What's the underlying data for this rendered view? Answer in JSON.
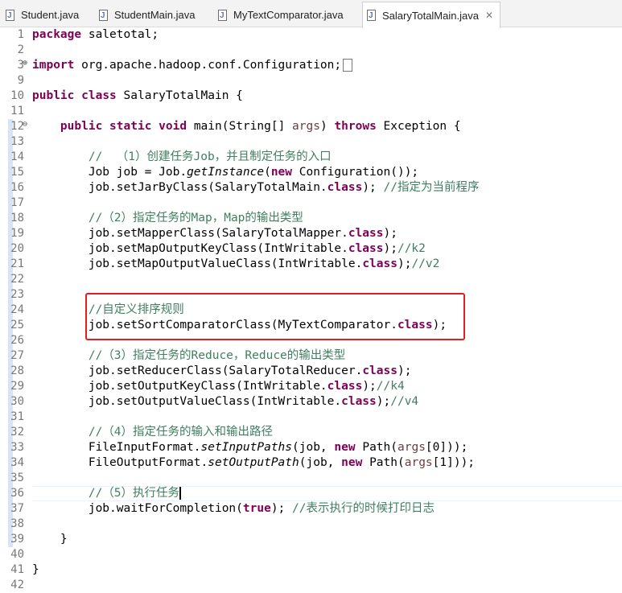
{
  "tabs": [
    {
      "label": "Student.java",
      "active": false
    },
    {
      "label": "StudentMain.java",
      "active": false
    },
    {
      "label": "MyTextComparator.java",
      "active": false
    },
    {
      "label": "SalaryTotalMain.java",
      "active": true
    }
  ],
  "tab_close_glyph": "✕",
  "code_lines": [
    {
      "n": "1",
      "text": "package saletotal;"
    },
    {
      "n": "2",
      "text": ""
    },
    {
      "n": "3",
      "text": "import org.apache.hadoop.conf.Configuration;"
    },
    {
      "n": "9",
      "text": ""
    },
    {
      "n": "10",
      "text": "public class SalaryTotalMain {"
    },
    {
      "n": "11",
      "text": ""
    },
    {
      "n": "12",
      "text": "    public static void main(String[] args) throws Exception {"
    },
    {
      "n": "13",
      "text": ""
    },
    {
      "n": "14",
      "text": "        //  （1）创建任务Job，并且制定任务的入口"
    },
    {
      "n": "15",
      "text": "        Job job = Job.getInstance(new Configuration());"
    },
    {
      "n": "16",
      "text": "        job.setJarByClass(SalaryTotalMain.class); //指定为当前程序"
    },
    {
      "n": "17",
      "text": ""
    },
    {
      "n": "18",
      "text": "        //（2）指定任务的Map，Map的输出类型"
    },
    {
      "n": "19",
      "text": "        job.setMapperClass(SalaryTotalMapper.class);"
    },
    {
      "n": "20",
      "text": "        job.setMapOutputKeyClass(IntWritable.class);//k2"
    },
    {
      "n": "21",
      "text": "        job.setMapOutputValueClass(IntWritable.class);//v2"
    },
    {
      "n": "22",
      "text": ""
    },
    {
      "n": "23",
      "text": ""
    },
    {
      "n": "24",
      "text": "        //自定义排序规则"
    },
    {
      "n": "25",
      "text": "        job.setSortComparatorClass(MyTextComparator.class);"
    },
    {
      "n": "26",
      "text": ""
    },
    {
      "n": "27",
      "text": "        //（3）指定任务的Reduce，Reduce的输出类型"
    },
    {
      "n": "28",
      "text": "        job.setReducerClass(SalaryTotalReducer.class);"
    },
    {
      "n": "29",
      "text": "        job.setOutputKeyClass(IntWritable.class);//k4"
    },
    {
      "n": "30",
      "text": "        job.setOutputValueClass(IntWritable.class);//v4"
    },
    {
      "n": "31",
      "text": ""
    },
    {
      "n": "32",
      "text": "        //（4）指定任务的输入和输出路径"
    },
    {
      "n": "33",
      "text": "        FileInputFormat.setInputPaths(job, new Path(args[0]));"
    },
    {
      "n": "34",
      "text": "        FileOutputFormat.setOutputPath(job, new Path(args[1]));"
    },
    {
      "n": "35",
      "text": ""
    },
    {
      "n": "36",
      "text": "        //（5）执行任务"
    },
    {
      "n": "37",
      "text": "        job.waitForCompletion(true); //表示执行的时候打印日志"
    },
    {
      "n": "38",
      "text": ""
    },
    {
      "n": "39",
      "text": "    }"
    },
    {
      "n": "40",
      "text": ""
    },
    {
      "n": "41",
      "text": "}"
    },
    {
      "n": "42",
      "text": ""
    }
  ],
  "colors": {
    "keyword": "#7f0055",
    "comment": "#3f7f5f",
    "highlight_box": "#e02020",
    "line_number": "#787878"
  }
}
